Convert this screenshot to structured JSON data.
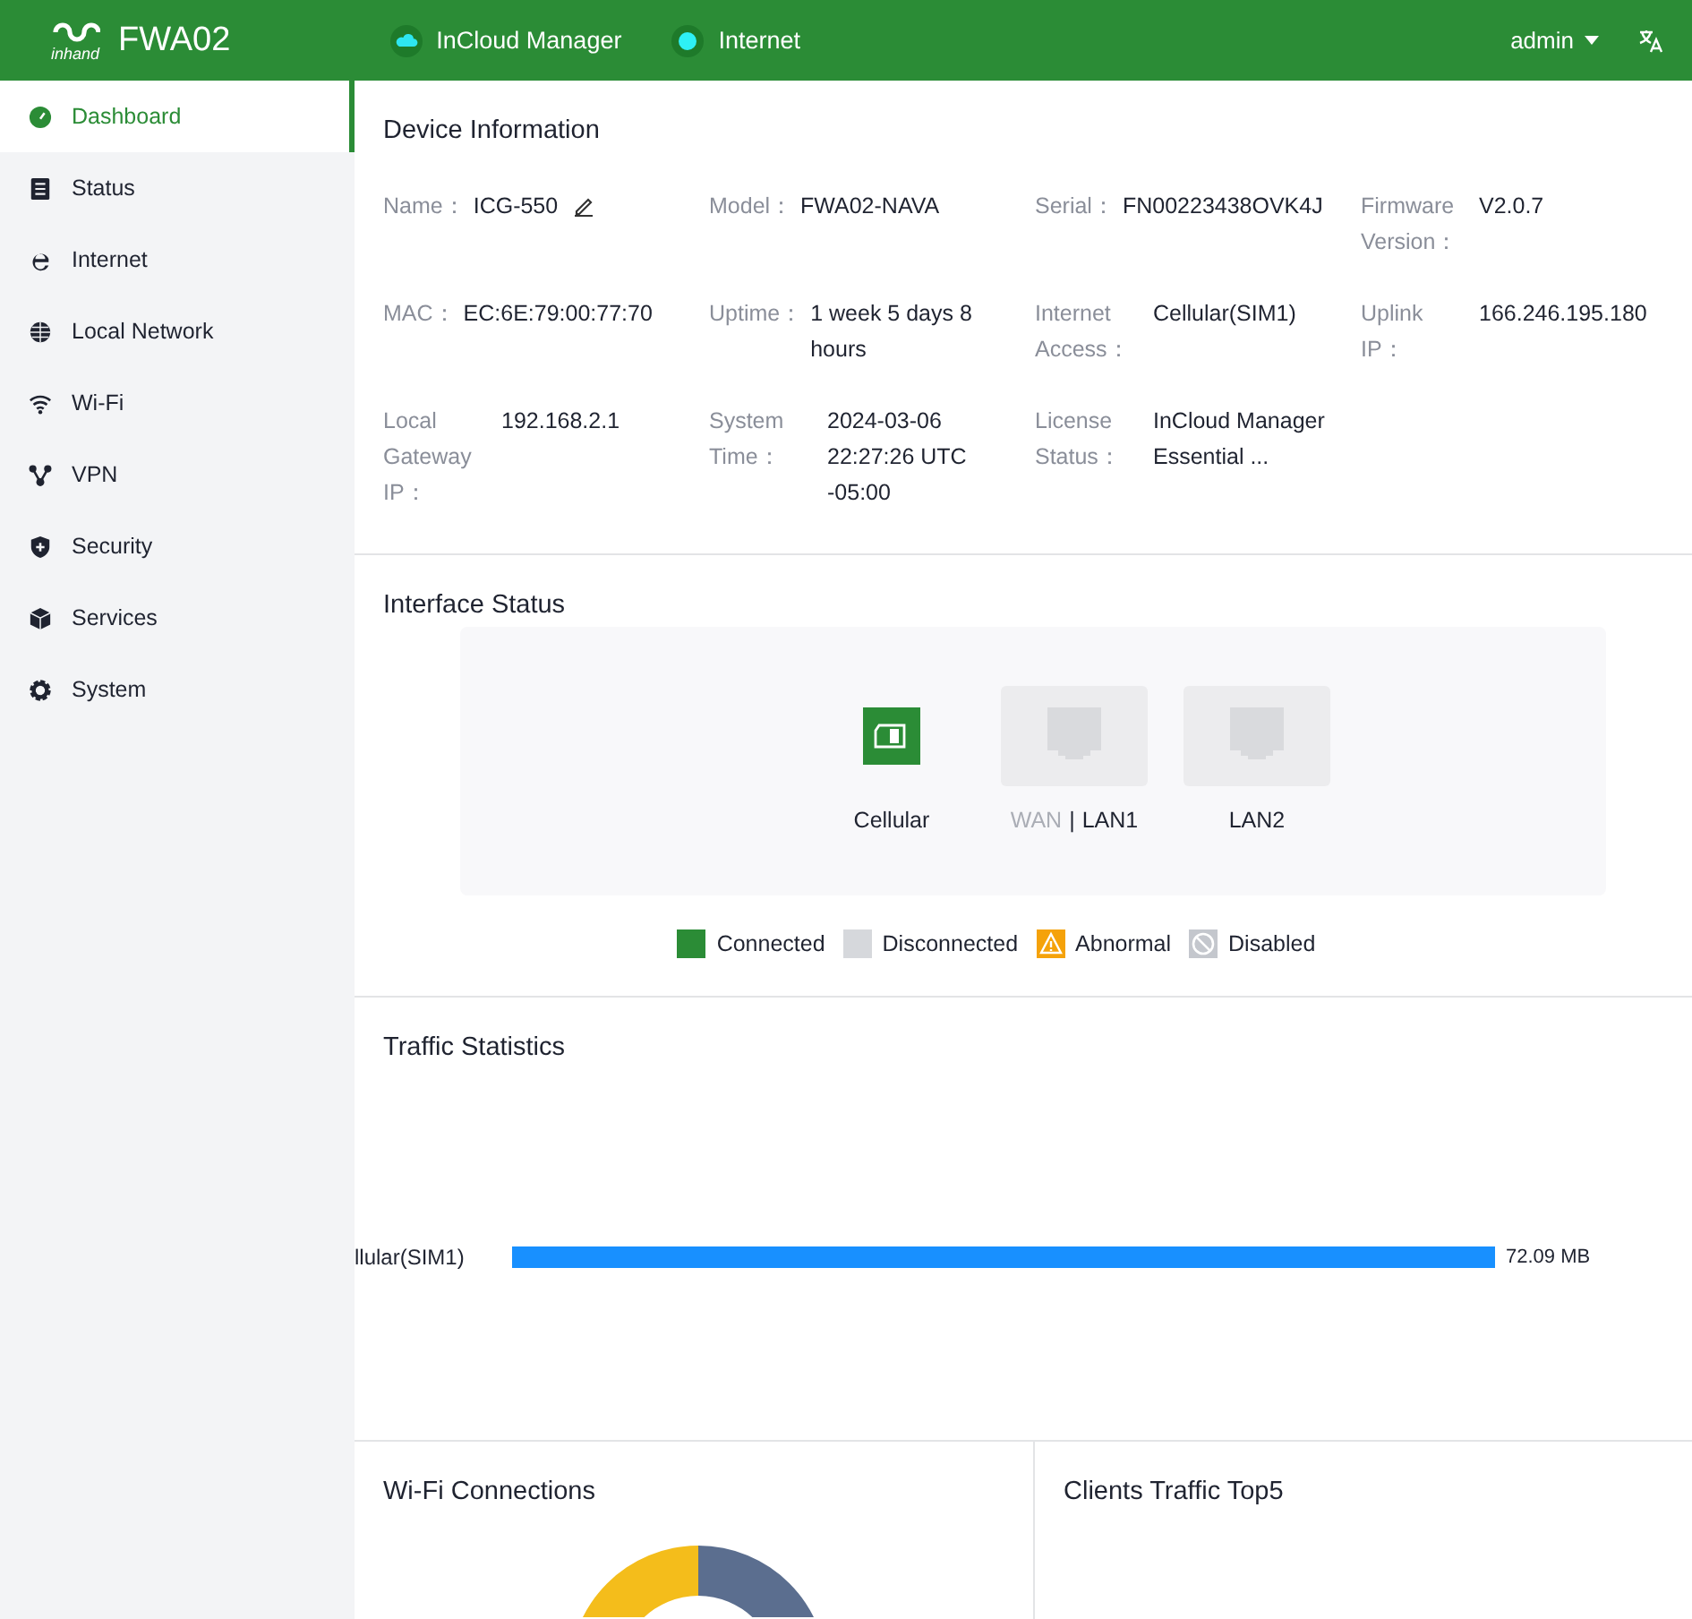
{
  "header": {
    "logo_sub": "inhand",
    "product": "FWA02",
    "status": [
      {
        "label": "InCloud Manager",
        "kind": "cloud"
      },
      {
        "label": "Internet",
        "kind": "dot"
      }
    ],
    "user": "admin"
  },
  "sidebar": {
    "items": [
      {
        "label": "Dashboard",
        "selected": true
      },
      {
        "label": "Status",
        "selected": false
      },
      {
        "label": "Internet",
        "selected": false
      },
      {
        "label": "Local Network",
        "selected": false
      },
      {
        "label": "Wi-Fi",
        "selected": false
      },
      {
        "label": "VPN",
        "selected": false
      },
      {
        "label": "Security",
        "selected": false
      },
      {
        "label": "Services",
        "selected": false
      },
      {
        "label": "System",
        "selected": false
      }
    ]
  },
  "device_info": {
    "title": "Device Information",
    "fields": [
      {
        "label": "Name：",
        "value": "ICG-550",
        "editable": true
      },
      {
        "label": "Model：",
        "value": "FWA02-NAVA",
        "editable": false
      },
      {
        "label": "Serial：",
        "value": "FN00223438OVK4J",
        "editable": false
      },
      {
        "label": "Firmware Version：",
        "value": "V2.0.7",
        "editable": false
      },
      {
        "label": "MAC：",
        "value": "EC:6E:79:00:77:70",
        "editable": false
      },
      {
        "label": "Uptime：",
        "value": "1 week 5 days 8 hours",
        "editable": false
      },
      {
        "label": "Internet Access：",
        "value": "Cellular(SIM1)",
        "editable": false
      },
      {
        "label": "Uplink IP：",
        "value": "166.246.195.180",
        "editable": false
      },
      {
        "label": "Local Gateway IP：",
        "value": "192.168.2.1",
        "editable": false
      },
      {
        "label": "System Time：",
        "value": "2024-03-06 22:27:26 UTC -05:00",
        "editable": false
      },
      {
        "label": "License Status：",
        "value": "InCloud Manager Essential ...",
        "editable": false
      }
    ]
  },
  "interface_status": {
    "title": "Interface Status",
    "ports": [
      {
        "kind": "sim",
        "connected": true,
        "labels": [
          {
            "text": "Cellular",
            "selected": true
          }
        ]
      },
      {
        "kind": "ethernet",
        "connected": false,
        "separator": "|",
        "labels": [
          {
            "text": "WAN",
            "selected": false
          },
          {
            "text": "LAN1",
            "selected": true
          }
        ]
      },
      {
        "kind": "ethernet",
        "connected": false,
        "labels": [
          {
            "text": "LAN2",
            "selected": true
          }
        ]
      }
    ],
    "legend": [
      {
        "label": "Connected",
        "kind": "connected",
        "color": "#2b8c36"
      },
      {
        "label": "Disconnected",
        "kind": "disconnected",
        "color": "#d6d8dc"
      },
      {
        "label": "Abnormal",
        "kind": "abnormal",
        "color": "#f5a20a"
      },
      {
        "label": "Disabled",
        "kind": "disabled",
        "color": "#c4c7cd"
      }
    ]
  },
  "traffic": {
    "title": "Traffic Statistics",
    "rows": [
      {
        "label": "llular(SIM1)",
        "reading": "72.09 MB"
      }
    ]
  },
  "wifi_connections": {
    "title": "Wi-Fi Connections"
  },
  "clients_traffic": {
    "title": "Clients Traffic Top5"
  }
}
